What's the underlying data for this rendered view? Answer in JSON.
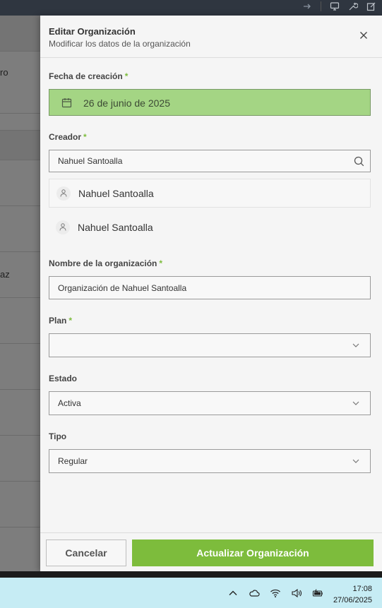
{
  "background": {
    "row_snippets": [
      "ro",
      "az"
    ]
  },
  "modal": {
    "title": "Editar Organización",
    "subtitle": "Modificar los datos de la organización"
  },
  "form": {
    "fecha": {
      "label": "Fecha de creación",
      "required_mark": "*",
      "value": "26 de junio de 2025"
    },
    "creador": {
      "label": "Creador",
      "required_mark": "*",
      "value": "Nahuel Santoalla",
      "suggestions": [
        "Nahuel Santoalla",
        "Nahuel Santoalla"
      ]
    },
    "nombre": {
      "label": "Nombre de la organización",
      "required_mark": "*",
      "value": "Organización de Nahuel Santoalla"
    },
    "plan": {
      "label": "Plan",
      "required_mark": "*",
      "value": ""
    },
    "estado": {
      "label": "Estado",
      "value": "Activa"
    },
    "tipo": {
      "label": "Tipo",
      "value": "Regular"
    }
  },
  "footer": {
    "cancel_label": "Cancelar",
    "submit_label": "Actualizar Organización"
  },
  "taskbar": {
    "time": "17:08",
    "date": "27/06/2025"
  },
  "colors": {
    "accent": "#7dbc3c",
    "date_field_bg": "#a4d584"
  }
}
